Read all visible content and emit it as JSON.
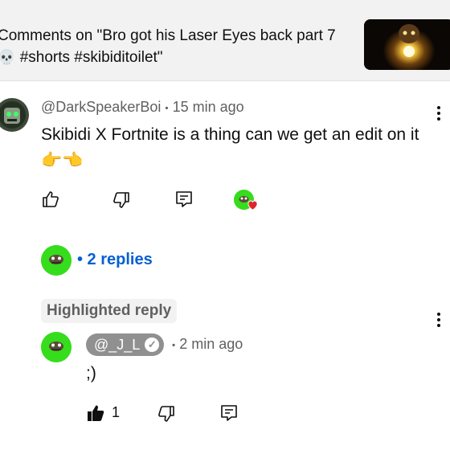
{
  "header": {
    "title_line1": "Comments on \"Bro got his Laser Eyes back part 7",
    "title_line2_emoji": "💀",
    "title_line2_text": " #shorts #skibiditoilet\""
  },
  "comment": {
    "author": "@DarkSpeakerBoi",
    "separator": "•",
    "time": "15 min ago",
    "text": "Skibidi X Fortnite is a thing can we get an edit on it 👉👈",
    "actions": {
      "like_icon": "thumbs-up-outline-icon",
      "dislike_icon": "thumbs-down-outline-icon",
      "reply_icon": "reply-icon",
      "creator_heart_icon": "creator-heart-icon"
    },
    "replies_label": "• 2 replies"
  },
  "highlighted_reply": {
    "chip_label": "Highlighted reply",
    "author": "@_J_L",
    "verified_icon": "verified-check-icon",
    "separator": "•",
    "time": "2 min ago",
    "text": ";)",
    "like_count": "1",
    "actions": {
      "like_icon": "thumbs-up-filled-icon",
      "dislike_icon": "thumbs-down-outline-icon",
      "reply_icon": "reply-icon"
    }
  },
  "colors": {
    "link": "#065fd4",
    "avatar_green": "#35dd1c",
    "heart": "#e0242f",
    "secondary_text": "#606060",
    "header_bg": "#f2f2f2"
  }
}
